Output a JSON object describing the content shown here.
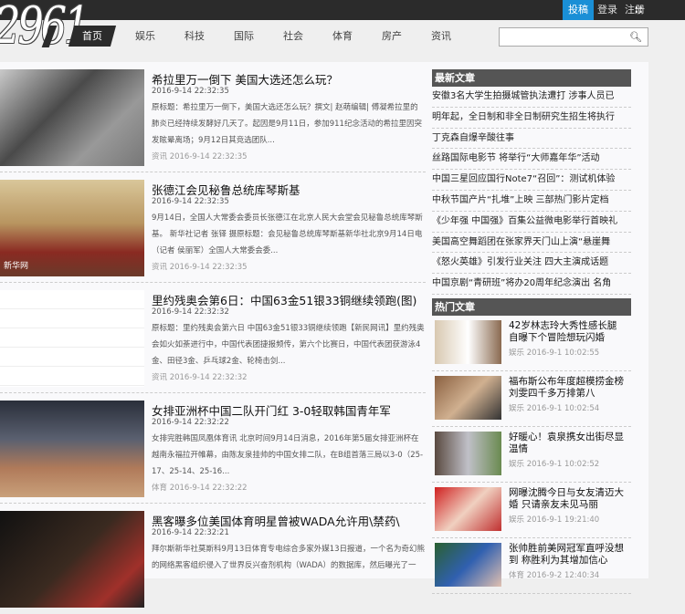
{
  "logo": "2961",
  "toplinks": [
    "投稿",
    "登录",
    "注册"
  ],
  "nav": [
    "首页",
    "娱乐",
    "科技",
    "国际",
    "社会",
    "体育",
    "房产",
    "资讯"
  ],
  "search": {
    "placeholder": ""
  },
  "articles": [
    {
      "title": "希拉里万一倒下 美国大选还怎么玩？",
      "date": "2016-9-14 22:32:35",
      "summary": "原标题：希拉里万一倒下，美国大选还怎么玩？撰文| 赵萌编辑| 傅凝希拉里的肺炎已经持续发酵好几天了。起因是9月11日，参加911纪念活动的希拉里因突发眩晕离场；9月12日其竞选团队...",
      "meta": "资讯 2016-9-14 22:32:35"
    },
    {
      "title": "张德江会见秘鲁总统库琴斯基",
      "date": "2016-9-14 22:32:35",
      "summary": "9月14日，全国人大常委会委员长张德江在北京人民大会堂会见秘鲁总统库琴斯基。 新华社记者 张铎 摄原标题：会见秘鲁总统库琴斯基新华社北京9月14日电（记者 侯丽军）全国人大常委会委...",
      "meta": "资讯 2016-9-14 22:32:35",
      "image_caption": "新华网"
    },
    {
      "title": "里约残奥会第6日：中国63金51银33铜继续领跑(图)",
      "date": "2016-9-14 22:32:32",
      "summary": "原标题：里约残奥会第六日 中国63金51银33铜继续领跑【新民网讯】里约残奥会如火如荼进行中，中国代表团捷报频传，第六个比赛日，中国代表团获游泳4金、田径3金、乒乓球2金、轮椅击剑...",
      "meta": "资讯 2016-9-14 22:32:32"
    },
    {
      "title": "女排亚洲杯中国二队开门红 3-0轻取韩国青年军",
      "date": "2016-9-14 22:32:22",
      "summary": "女排完胜韩国凤凰体育讯 北京时间9月14日消息，2016年第5届女排亚洲杯在越南永福拉开帷幕，由陈友泉挂帅的中国女排二队，在B组首落三局以3-0（25-17、25-14、25-16...",
      "meta": "体育 2016-9-14 22:32:22"
    },
    {
      "title": "黑客曝多位美国体育明星曾被WADA允许用\\禁药\\",
      "date": "2016-9-14 22:32:21",
      "summary": "拜尔斯新华社莫斯科9月13日体育专电综合多家外媒13日报道，一个名为奇幻熊的网络黑客组织侵入了世界反兴奋剂机构（WADA）的数据库，然后曝光了一",
      "meta": ""
    }
  ],
  "sidebar": {
    "latest_title": "最新文章",
    "latest": [
      "安徽3名大学生拍摄城管执法遭打 涉事人员已",
      "明年起，全日制和非全日制研究生招生将执行",
      "丁克森自爆辛酸往事",
      "丝路国际电影节 将举行“大师嘉年华”活动",
      "中国三星回应国行Note7“召回”：测试机体验",
      "中秋节国产片“扎堆”上映 三部热门影片定档",
      "《少年强 中国强》百集公益微电影举行首映礼",
      "美国高空舞蹈团在张家界天门山上演“悬崖舞",
      "《怒火英雄》引发行业关注 四大主演成话题",
      "中国京剧“青研班”将办20周年纪念演出 名角"
    ],
    "hot_title": "热门文章",
    "hot": [
      {
        "title": "42岁林志玲大秀性感长腿 自曝下个冒险想玩闪婚",
        "meta": "娱乐 2016-9-1 10:02:55"
      },
      {
        "title": "福布斯公布年度超模捞金榜 刘雯四千多万排第八",
        "meta": "娱乐 2016-9-1 10:02:54"
      },
      {
        "title": "好暖心！袁泉携女出街尽显温情",
        "meta": "娱乐 2016-9-1 10:02:52"
      },
      {
        "title": "网曝沈腾今日与女友清迈大婚 只请亲友未见马丽",
        "meta": "娱乐 2016-9-1 19:21:40"
      },
      {
        "title": "张帅胜前美网冠军直呼没想到 称胜利为其增加信心",
        "meta": "体育 2016-9-2 12:40:34"
      }
    ]
  },
  "colors": {
    "accent": "#1a8fd6",
    "dark": "#2b2b2b",
    "sidebar_header": "#555555"
  }
}
